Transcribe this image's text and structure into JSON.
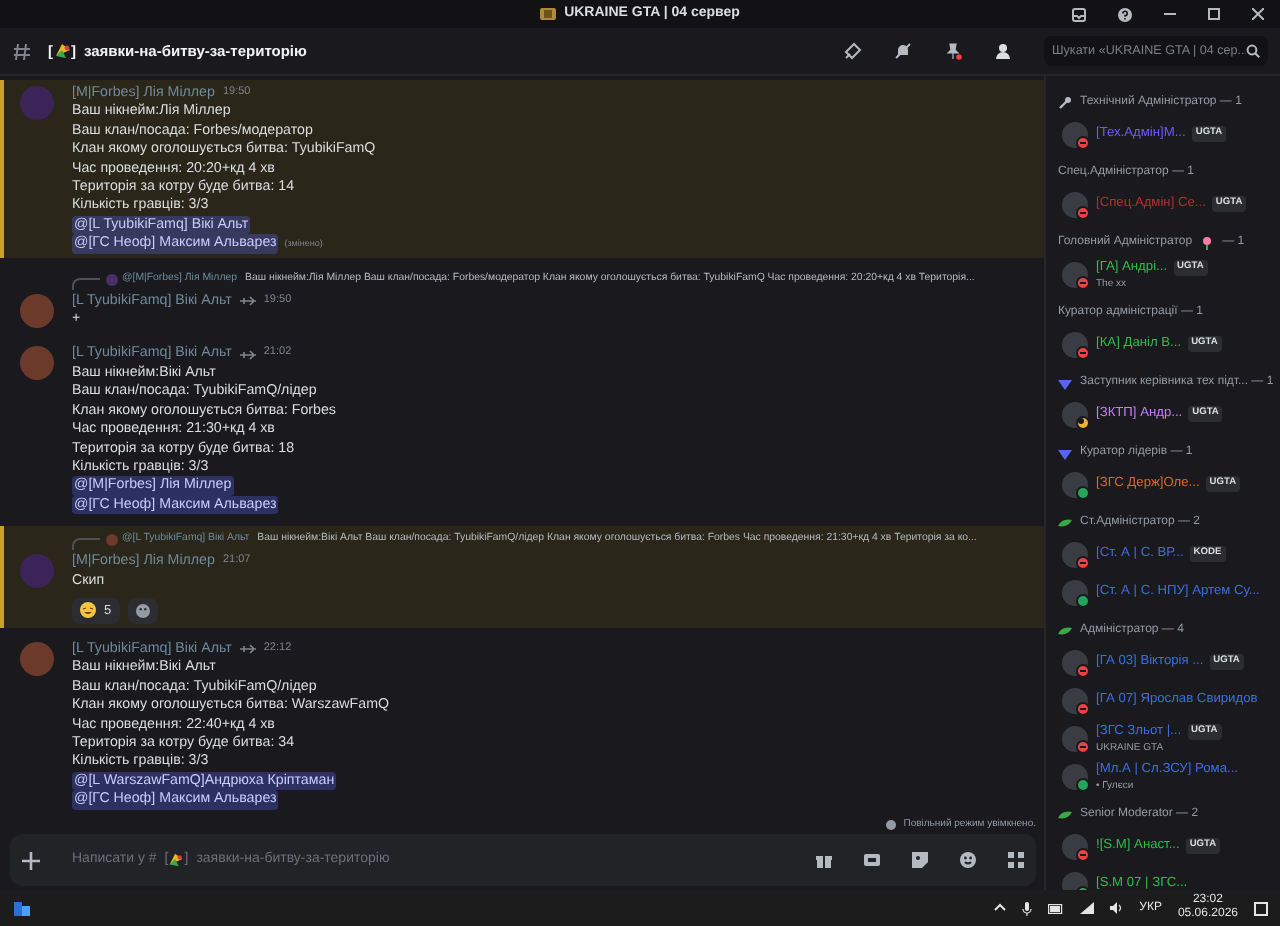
{
  "window": {
    "title": "UKRAINE GTA | 04 сервер"
  },
  "channel": {
    "open": "[",
    "close": "]",
    "name": "заявки-на-битву-за-територію",
    "search_placeholder": "Шукати «UKRAINE GTA | 04 сер..."
  },
  "messages": [
    {
      "highlighted": true,
      "author": "[M|Forbes] Лія Міллер",
      "author_icon": false,
      "time": "19:50",
      "lines": [
        "Ваш нікнейм:Лія Міллер",
        "Ваш клан/посада: Forbes/модератор",
        "Клан якому оголошується битва: TyubikiFamQ",
        "Час проведення: 20:20+кд 4 хв",
        "Територія за котру буде битва: 14",
        "Кількість гравців: 3/3"
      ],
      "mentions": [
        "@[L TyubikiFamq] Вікі Альт",
        "@[ГС Неоф] Максим Альварез"
      ],
      "edited": "(змінено)"
    },
    {
      "highlighted": false,
      "reply_to": {
        "author": "@[M|Forbes] Лія Міллер",
        "text": "Ваш нікнейм:Лія Міллер Ваш клан/посада: Forbes/модератор Клан якому оголошується битва: TyubikiFamQ Час проведення: 20:20+кд 4 хв Територія..."
      },
      "author": "[L TyubikiFamq] Вікі Альт",
      "author_icon": true,
      "time": "19:50",
      "lines": [
        "+"
      ]
    },
    {
      "highlighted": false,
      "author": "[L TyubikiFamq] Вікі Альт",
      "author_icon": true,
      "time": "21:02",
      "lines": [
        "Ваш нікнейм:Вікі Альт",
        "Ваш клан/посада: TyubikiFamQ/лідер",
        "Клан якому оголошується битва:  Forbes",
        "Час проведення: 21:30+кд 4 хв",
        "Територія за котру буде битва: 18",
        "Кількість гравців: 3/3"
      ],
      "mentions": [
        "@[M|Forbes] Лія Міллер",
        "@[ГС Неоф] Максим Альварез"
      ]
    },
    {
      "highlighted": true,
      "reply_to": {
        "author": "@[L TyubikiFamq] Вікі Альт",
        "text": "Ваш нікнейм:Вікі Альт Ваш клан/посада: TyubikiFamQ/лідер Клан якому оголошується битва:  Forbes Час проведення: 21:30+кд 4 хв Територія за ко..."
      },
      "author": "[M|Forbes] Лія Міллер",
      "author_icon": false,
      "time": "21:07",
      "lines": [
        "Скип"
      ],
      "reactions": [
        {
          "count": "5"
        }
      ]
    },
    {
      "highlighted": false,
      "author": "[L TyubikiFamq] Вікі Альт",
      "author_icon": true,
      "time": "22:12",
      "lines": [
        "Ваш нікнейм:Вікі Альт",
        "Ваш клан/посада: TyubikiFamQ/лідер",
        "Клан якому оголошується битва:  WarszawFamQ",
        "Час проведення: 22:40+кд 4 хв",
        "Територія за котру буде битва: 34",
        "Кількість гравців: 3/3"
      ],
      "mentions": [
        "@[L WarszawFamQ]Андрюха Кріптаман",
        "@[ГС Неоф] Максим Альварез"
      ]
    }
  ],
  "slow_mode": "Повільний режим увімкнено.",
  "composer": {
    "prefix": "Написати у #",
    "open": "[",
    "close": "]",
    "channel": "заявки-на-битву-за-територію"
  },
  "member_groups": [
    {
      "title": "Технічний Адміністратор — 1",
      "members": [
        {
          "name": "[Тех.Адмін]М...",
          "color": "#6b5cff",
          "badge": "UGTA",
          "dnd": true,
          "idle": false
        }
      ]
    },
    {
      "title": "Спец.Адміністратор — 1",
      "members": [
        {
          "name": "[Спец.Адмін] Се...",
          "color": "#b5302c",
          "badge": "UGTA",
          "dnd": true,
          "idle": false
        }
      ]
    },
    {
      "title": "Головний Адміністратор",
      "count": "— 1",
      "members": [
        {
          "name": "[ГА] Андрі...",
          "color": "#2fbf4a",
          "badge": "UGTA",
          "activity": "The xx",
          "dnd": true,
          "idle": false
        }
      ]
    },
    {
      "title": "Куратор адміністрації — 1",
      "members": [
        {
          "name": "[КА] Даніл В...",
          "color": "#2fbf4a",
          "badge": "UGTA",
          "dnd": true,
          "idle": false
        }
      ]
    },
    {
      "title": "Заступник керівника тех підт... — 1",
      "members": [
        {
          "name": "[ЗКТП] Андр...",
          "color": "#c77dff",
          "badge": "UGTA",
          "dnd": false,
          "idle": true
        }
      ]
    },
    {
      "title": "Куратор лідерів — 1",
      "members": [
        {
          "name": "[ЗГС Держ]Оле...",
          "color": "#e0662b",
          "badge": "UGTA",
          "dnd": false,
          "idle": false
        }
      ]
    },
    {
      "title": "Ст.Адміністратор — 2",
      "members": [
        {
          "name": "[Ст. А | С. ВР...",
          "color": "#3b6fe0",
          "badge": "KODE",
          "dnd": true,
          "idle": false
        },
        {
          "name": "[Ст. А | С. НПУ] Артем Су...",
          "color": "#3b6fe0",
          "dnd": false,
          "idle": false
        }
      ]
    },
    {
      "title": "Адміністратор — 4",
      "members": [
        {
          "name": "[ГА 03] Вікторія ...",
          "color": "#3b6fe0",
          "badge": "UGTA",
          "dnd": true,
          "idle": false
        },
        {
          "name": "[ГА 07] Ярослав Свиридов",
          "color": "#3b6fe0",
          "dnd": true,
          "idle": false
        },
        {
          "name": "[ЗГС Зльот |...",
          "color": "#3b6fe0",
          "badge": "UGTA",
          "activity": "UKRAINE GTA",
          "dnd": true,
          "idle": false
        },
        {
          "name": "[Мл.А | Сл.ЗСУ] Рома...",
          "color": "#3b6fe0",
          "activity": "• Гулєси",
          "dnd": false,
          "idle": false
        }
      ]
    },
    {
      "title": "Senior Moderator — 2",
      "members": [
        {
          "name": "![S.M] Анаст...",
          "color": "#2fbf4a",
          "badge": "UGTA",
          "dnd": true,
          "idle": false
        },
        {
          "name": "[S.M 07 | ЗГС...",
          "color": "#2fbf4a",
          "dnd": false,
          "idle": false
        }
      ]
    }
  ],
  "taskbar": {
    "language": "УКР",
    "time": "23:02",
    "date": "05.06.2026"
  }
}
